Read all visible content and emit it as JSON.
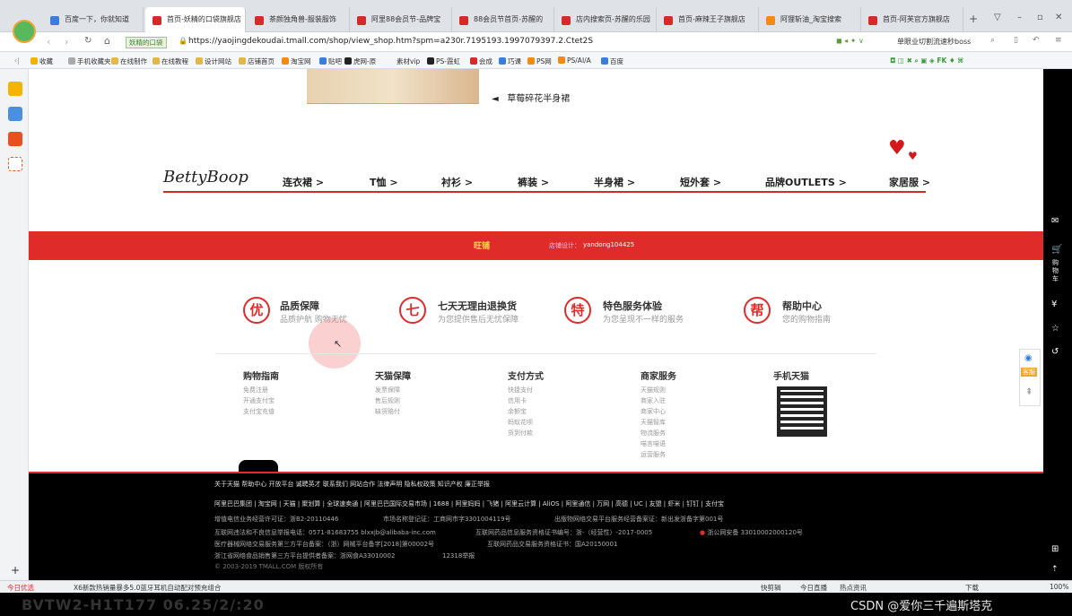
{
  "browser": {
    "tabs": [
      {
        "label": "百度一下，你就知道",
        "active": false
      },
      {
        "label": "首页-妖精的口袋旗舰店",
        "active": true
      },
      {
        "label": "茶颜独角兽-服装服饰",
        "active": false
      },
      {
        "label": "阿里88会员节-品牌宝",
        "active": false
      },
      {
        "label": "88会员节首页-苏醒的",
        "active": false
      },
      {
        "label": "店内搜索页-苏醒的乐园",
        "active": false
      },
      {
        "label": "首页-麻辣王子旗舰店",
        "active": false
      },
      {
        "label": "阿狸斩油_淘宝搜索",
        "active": false
      },
      {
        "label": "首页-阿芙官方旗舰店",
        "active": false
      }
    ],
    "shop_badge": "妖精的口袋",
    "url": "https://yaojingdekoudai.tmall.com/shop/view_shop.htm?spm=a230r.7195193.1997079397.2.Ctet2S",
    "search_hint": "单眼业切割流速秒boss",
    "bookmarks": [
      "收藏",
      "手机收藏夹",
      "在线制作",
      "在线教程",
      "设计网站",
      "店铺首页",
      "淘宝网",
      "贴吧",
      "虎网-原",
      "素材vip",
      "PS-霞虹",
      "会成",
      "巧课",
      "PS网",
      "PS/AI/A",
      "百度"
    ]
  },
  "shop": {
    "top_product_caption": "草莓碎花半身裙",
    "brand_logo": "BettyBoop",
    "nav": [
      "连衣裙 >",
      "T恤 >",
      "衬衫 >",
      "裤装 >",
      "半身裙 >",
      "短外套 >",
      "品牌OUTLETS >",
      "家居服 >"
    ],
    "wangpu": "旺铺",
    "designer_label": "店铺设计：",
    "designer": "yandong104425"
  },
  "services": [
    {
      "icon": "优",
      "title": "品质保障",
      "sub": "品质护航 购物无忧"
    },
    {
      "icon": "七",
      "title": "七天无理由退换货",
      "sub": "为您提供售后无忧保障"
    },
    {
      "icon": "特",
      "title": "特色服务体验",
      "sub": "为您呈现不一样的服务"
    },
    {
      "icon": "帮",
      "title": "帮助中心",
      "sub": "您的购物指南"
    }
  ],
  "footer_cols": [
    {
      "title": "购物指南",
      "links": [
        "免费注册",
        "开通支付宝",
        "支付宝充值"
      ]
    },
    {
      "title": "天猫保障",
      "links": [
        "发票保障",
        "售后规则",
        "缺货赔付"
      ]
    },
    {
      "title": "支付方式",
      "links": [
        "快捷支付",
        "信用卡",
        "余额宝",
        "蚂蚁花呗",
        "货到付款"
      ]
    },
    {
      "title": "商家服务",
      "links": [
        "天猫规则",
        "商家入驻",
        "商家中心",
        "天猫智库",
        "物流服务",
        "喵言喵语",
        "运营服务"
      ]
    },
    {
      "title": "手机天猫",
      "links": []
    }
  ],
  "black_footer": {
    "row1": "关于天猫  帮助中心  开放平台  诚聘英才  联系我们  网站合作  法律声明  隐私权政策  知识产权  廉正举报",
    "row2": "阿里巴巴集团 | 淘宝网 | 天猫 | 聚划算 | 全球速卖通 | 阿里巴巴国际交易市场 | 1688 | 阿里妈妈 | 飞猪 | 阿里云计算 | AliOS | 阿里通信 | 万网 | 高德 | UC | 友盟 | 虾米 | 钉钉 | 支付宝",
    "r3a": "增值电信业务经营许可证：浙B2-20110446",
    "r3b": "市场名称登记证：工商网市字3301004119号",
    "r3c": "出版物网络交易平台服务经营备案证：新出发浙备字第001号",
    "r4a": "互联网违法和不良信息举报电话：0571-81683755 blxxjb@alibaba-inc.com",
    "r4b": "互联网药品信息服务资格证书编号：浙-（经营性）-2017-0005",
    "r4c": "浙公网安备 33010002000120号",
    "r5a": "医疗器械网络交易服务第三方平台备案：（浙）网械平台备字[2018]第00002号",
    "r5b": "互联网药品交易服务资格证书：国A20150001",
    "r6a": "浙江省网络食品销售第三方平台提供者备案：浙网食A33010002",
    "r6b": "12318举报",
    "copyright": "© 2003-2019 TMALL.COM 版权所有"
  },
  "right_panel": {
    "cart": "购物车",
    "chat": "客服"
  },
  "statusbar": {
    "left": "今日优选",
    "news": "X6新款热销量暴多5.0蓝牙耳机自动配对预充组合",
    "items": [
      "快剪辑",
      "今日直播",
      "热点资讯",
      "下载",
      "100%"
    ]
  },
  "taskbar": {
    "watermark": "CSDN @爱你三千遍斯塔克",
    "timestamp": "BVTW2-H1T177 06.25/2/:20"
  },
  "colors": {
    "accent": "#e02b2b",
    "footer": "#000000"
  }
}
